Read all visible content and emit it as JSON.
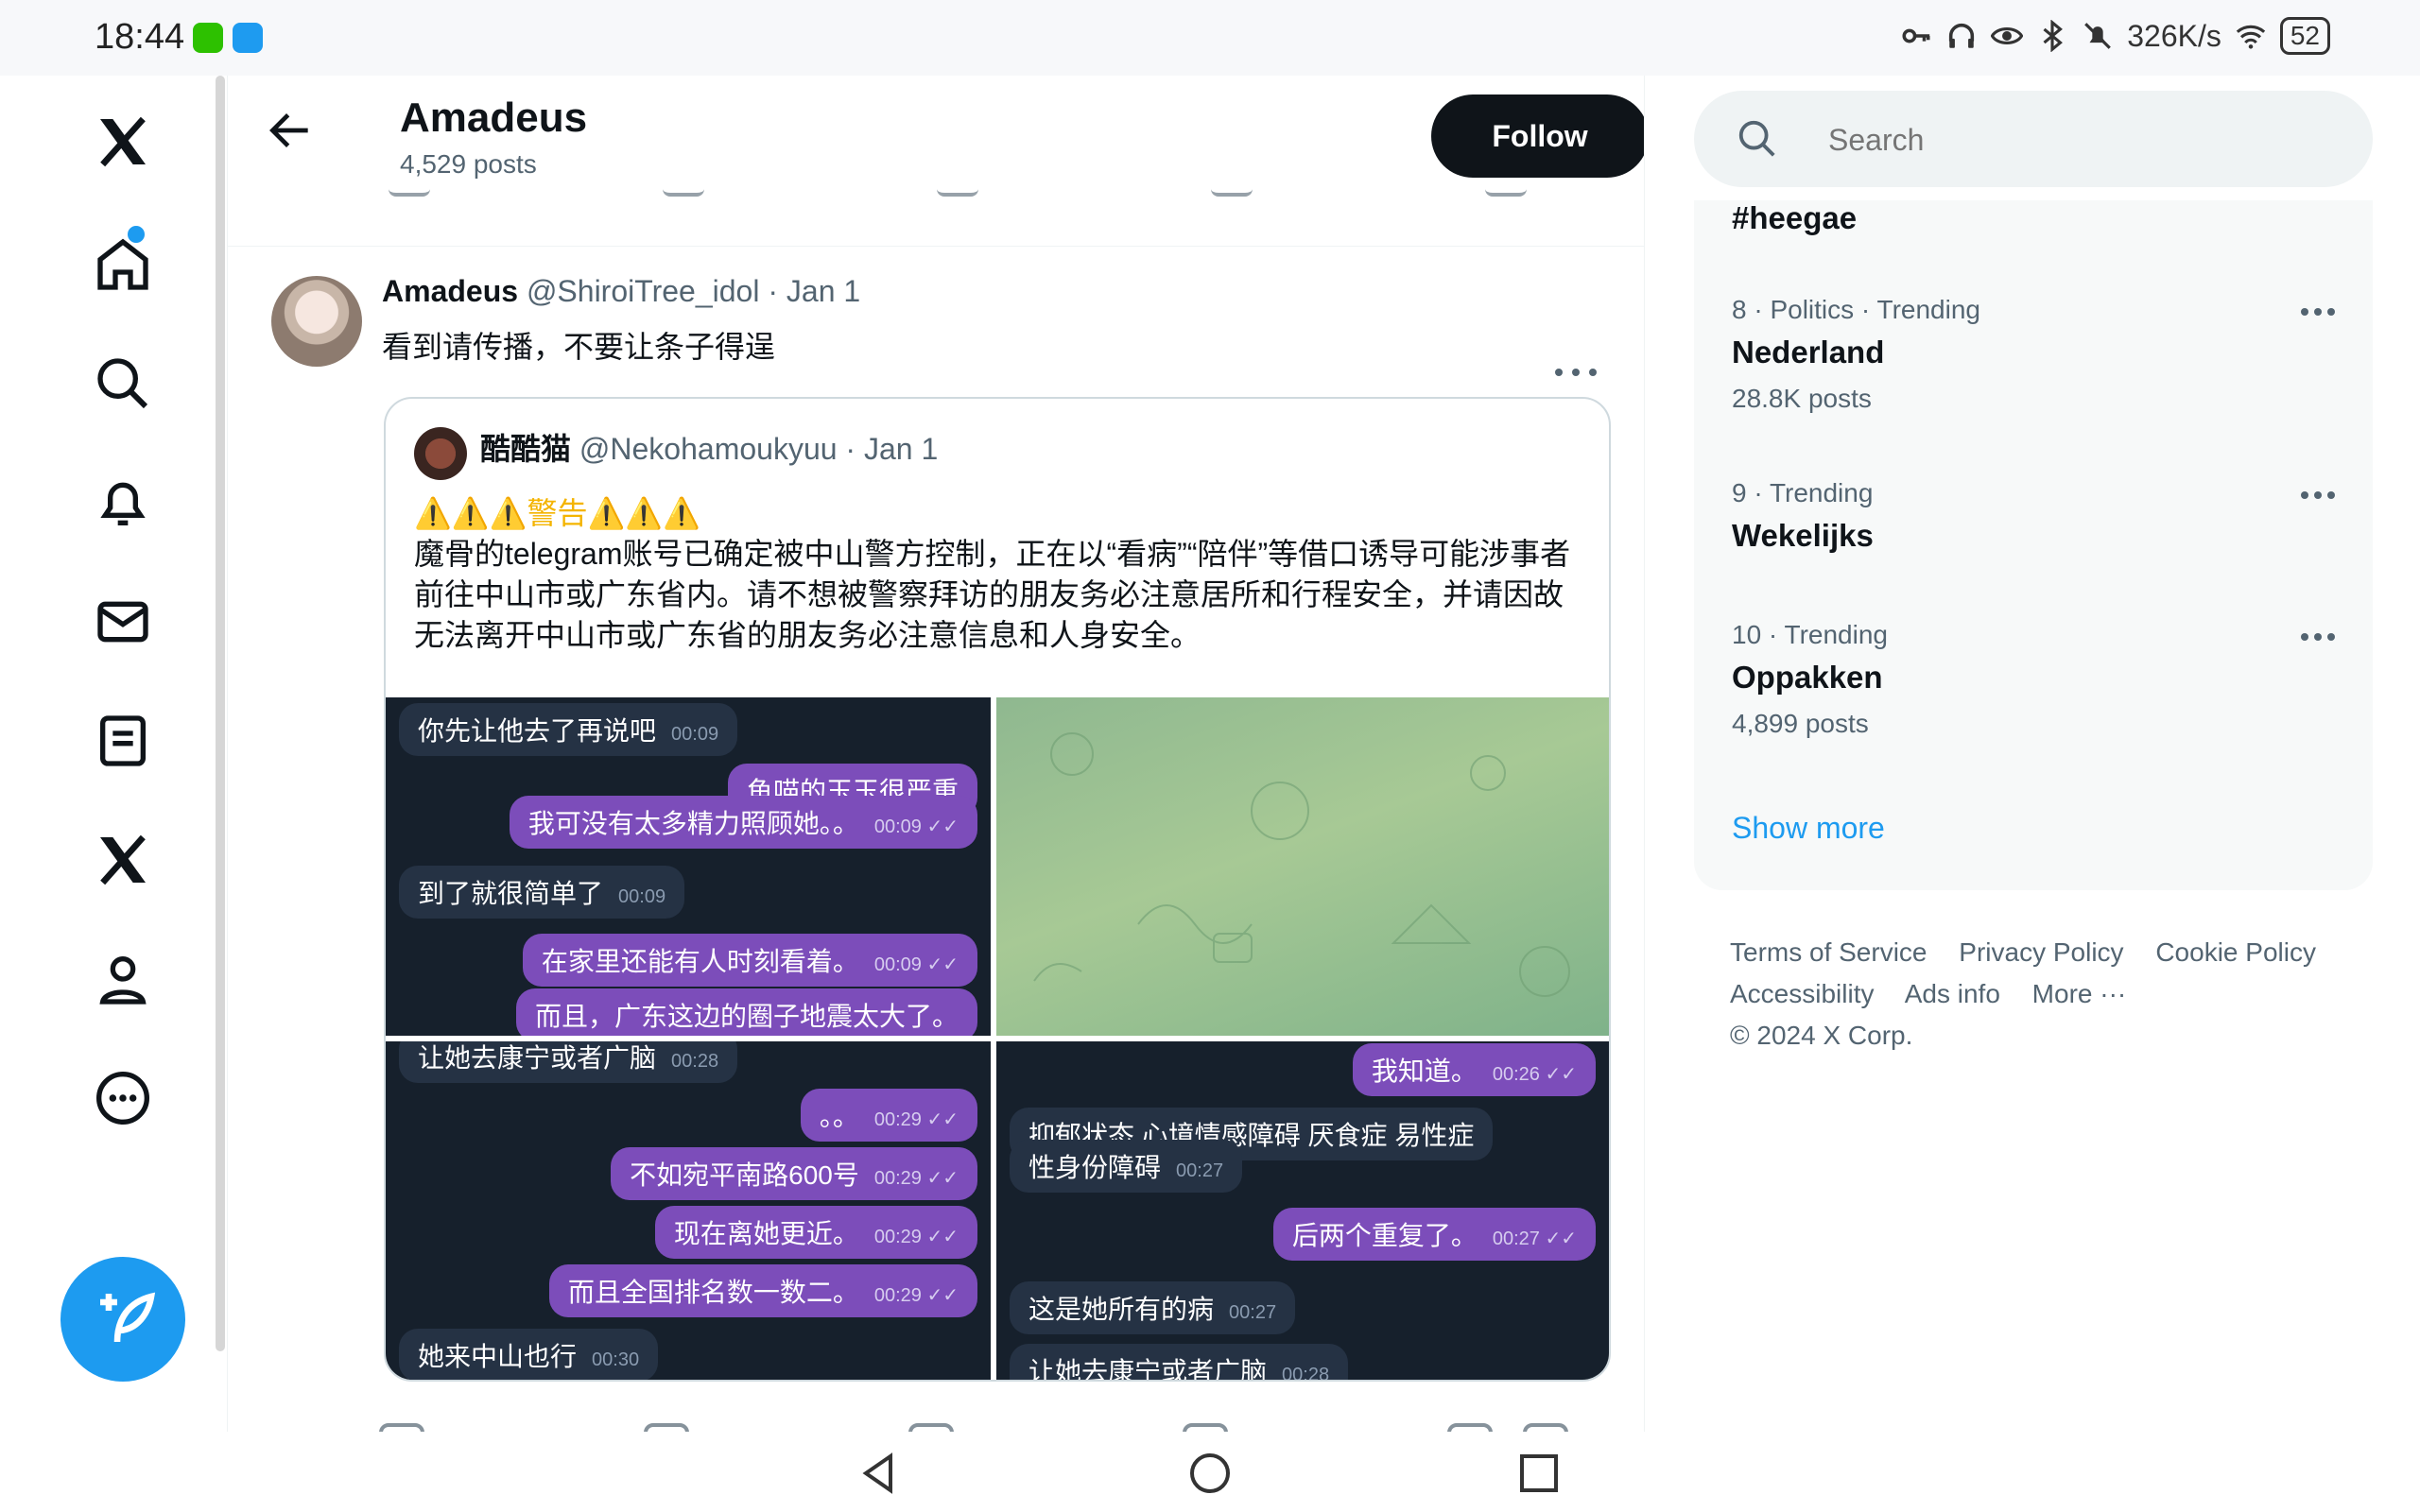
{
  "status_bar": {
    "time": "18:44",
    "net_speed": "326K/s",
    "battery": "52"
  },
  "nav": {
    "items": [
      "x-logo",
      "home",
      "explore",
      "notifications",
      "messages",
      "lists",
      "premium",
      "profile",
      "more"
    ],
    "post_label": "Post"
  },
  "header": {
    "title": "Amadeus",
    "posts": "4,529 posts",
    "follow_label": "Follow"
  },
  "tweet": {
    "name": "Amadeus",
    "handle": "@ShiroiTree_idol",
    "date": "· Jan 1",
    "text": "看到请传播，不要让条子得逞",
    "quote": {
      "name": "酷酷猫",
      "handle": "@Nekohamoukyuu",
      "date": "· Jan 1",
      "warning": "⚠️⚠️⚠️警告⚠️⚠️⚠️",
      "body": "魔骨的telegram账号已确定被中山警方控制，正在以“看病”“陪伴”等借口诱导可能涉事者前往中山市或广东省内。请不想被警察拜访的朋友务必注意居所和行程安全，并请因故无法离开中山市或广东省的朋友务必注意信息和人身安全。",
      "chat1": [
        {
          "text": "你先让他去了再说吧",
          "time": "00:09",
          "in": true
        },
        {
          "text": "鱼喵的玉玉很严重",
          "time": "",
          "in": false
        },
        {
          "text": "我可没有太多精力照顾她。。",
          "time": "00:09",
          "in": false
        },
        {
          "text": "到了就很简单了",
          "time": "00:09",
          "in": true
        },
        {
          "text": "在家里还能有人时刻看着。",
          "time": "00:09",
          "in": false
        },
        {
          "text": "而且，广东这边的圈子地震太大了。",
          "time": "",
          "in": false
        }
      ],
      "chat3": [
        {
          "text": "让她去康宁或者广脑",
          "time": "00:28",
          "in": true
        },
        {
          "text": "。。",
          "time": "00:29",
          "in": false
        },
        {
          "text": "不如宛平南路600号",
          "time": "00:29",
          "in": false
        },
        {
          "text": "现在离她更近。",
          "time": "00:29",
          "in": false
        },
        {
          "text": "而且全国排名数一数二。",
          "time": "00:29",
          "in": false
        },
        {
          "text": "她来中山也行",
          "time": "00:30",
          "in": true
        }
      ],
      "chat4": [
        {
          "text": "我知道。",
          "time": "00:26",
          "in": false
        },
        {
          "text": "抑郁状态 心境情感障碍 厌食症 易性症",
          "time": "",
          "in": true
        },
        {
          "text": "性身份障碍",
          "time": "00:27",
          "in": true
        },
        {
          "text": "后两个重复了。",
          "time": "00:27",
          "in": false
        },
        {
          "text": "这是她所有的病",
          "time": "00:27",
          "in": true
        },
        {
          "text": "让她去康宁或者广脑",
          "time": "00:28",
          "in": true
        }
      ]
    }
  },
  "search": {
    "placeholder": "Search"
  },
  "trends": {
    "top_tag": "#heegae",
    "items": [
      {
        "context": "8 · Politics · Trending",
        "name": "Nederland",
        "count": "28.8K posts"
      },
      {
        "context": "9 · Trending",
        "name": "Wekelijks",
        "count": ""
      },
      {
        "context": "10 · Trending",
        "name": "Oppakken",
        "count": "4,899 posts"
      }
    ],
    "show_more": "Show more"
  },
  "footer": {
    "links": [
      "Terms of Service",
      "Privacy Policy",
      "Cookie Policy",
      "Accessibility",
      "Ads info",
      "More ···"
    ],
    "copyright": "© 2024 X Corp."
  },
  "colors": {
    "accent": "#1d9bf0",
    "chat_out": "#7c4dba",
    "chat_bg": "#16202c"
  }
}
